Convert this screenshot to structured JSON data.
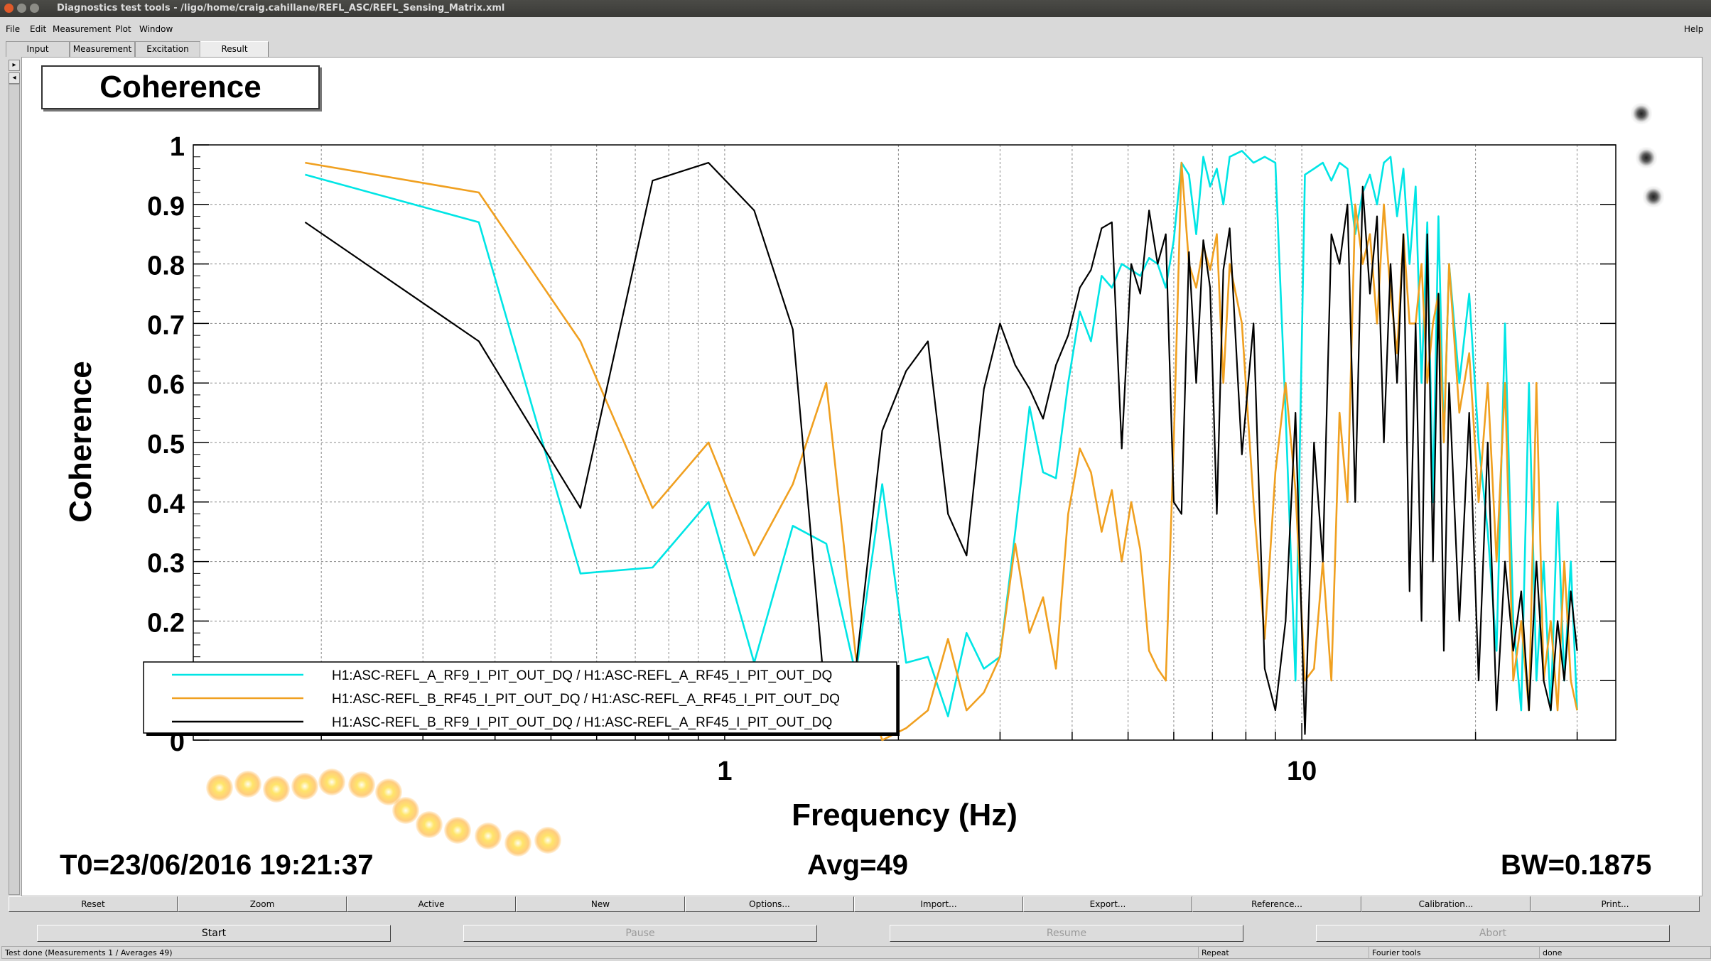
{
  "window": {
    "title": "Diagnostics test tools - /ligo/home/craig.cahillane/REFL_ASC/REFL_Sensing_Matrix.xml"
  },
  "menu": {
    "items": [
      "File",
      "Edit",
      "Measurement",
      "Plot",
      "Window"
    ],
    "help": "Help"
  },
  "tabs": [
    "Input",
    "Measurement",
    "Excitation",
    "Result"
  ],
  "active_tab": "Result",
  "plot_title": "Coherence",
  "status": {
    "t0": "T0=23/06/2016 19:21:37",
    "avg": "Avg=49",
    "bw": "BW=0.1875"
  },
  "buttons_row1": [
    "Reset",
    "Zoom",
    "Active",
    "New",
    "Options...",
    "Import...",
    "Export...",
    "Reference...",
    "Calibration...",
    "Print..."
  ],
  "buttons_row2": [
    "Start",
    "Pause",
    "Resume",
    "Abort"
  ],
  "statusbar": {
    "message": "Test done (Measurements 1 / Averages 49)",
    "repeat": "Repeat",
    "tools": "Fourier tools",
    "state": "done"
  },
  "colors": {
    "series_cyan": "#00e5e5",
    "series_orange": "#f0a020",
    "series_black": "#000000"
  },
  "chart_data": {
    "type": "line",
    "title": "",
    "xlabel": "Frequency (Hz)",
    "ylabel": "Coherence",
    "xscale": "log",
    "xlim": [
      0.12,
      35
    ],
    "ylim": [
      0,
      1
    ],
    "x_tick_labels": [
      "1",
      "10"
    ],
    "y_tick_labels": [
      "0",
      "0.1",
      "0.2",
      "0.3",
      "0.4",
      "0.5",
      "0.6",
      "0.7",
      "0.8",
      "0.9",
      "1"
    ],
    "grid": true,
    "legend_position": "bottom-left",
    "series": [
      {
        "name": "H1:ASC-REFL_A_RF9_I_PIT_OUT_DQ / H1:ASC-REFL_A_RF45_I_PIT_OUT_DQ",
        "color": "#00e5e5",
        "x": [
          0.1875,
          0.375,
          0.5625,
          0.75,
          0.9375,
          1.125,
          1.3125,
          1.5,
          1.6875,
          1.875,
          2.0625,
          2.25,
          2.4375,
          2.625,
          2.8125,
          3.0,
          3.1875,
          3.375,
          3.5625,
          3.75,
          3.9375,
          4.125,
          4.3125,
          4.5,
          4.6875,
          4.875,
          5.0625,
          5.25,
          5.4375,
          5.625,
          5.8125,
          6.0,
          6.1875,
          6.375,
          6.5625,
          6.75,
          6.9375,
          7.125,
          7.3125,
          7.5,
          7.875,
          8.25,
          8.625,
          9.0,
          9.375,
          9.75,
          10.125,
          10.5,
          10.875,
          11.25,
          11.625,
          12.0,
          12.375,
          12.75,
          13.125,
          13.5,
          13.875,
          14.25,
          14.625,
          15.0,
          15.375,
          15.75,
          16.125,
          16.5,
          16.875,
          17.25,
          17.625,
          18.0,
          18.75,
          19.5,
          20.25,
          21.0,
          21.75,
          22.5,
          23.25,
          24.0,
          24.75,
          25.5,
          26.25,
          27.0,
          27.75,
          28.5,
          29.25,
          30.0
        ],
        "y": [
          0.95,
          0.87,
          0.28,
          0.29,
          0.4,
          0.13,
          0.36,
          0.33,
          0.11,
          0.43,
          0.13,
          0.14,
          0.04,
          0.18,
          0.12,
          0.14,
          0.35,
          0.56,
          0.45,
          0.44,
          0.6,
          0.72,
          0.67,
          0.78,
          0.76,
          0.8,
          0.79,
          0.78,
          0.81,
          0.8,
          0.76,
          0.84,
          0.97,
          0.95,
          0.85,
          0.98,
          0.93,
          0.96,
          0.9,
          0.98,
          0.99,
          0.97,
          0.98,
          0.97,
          0.55,
          0.1,
          0.95,
          0.96,
          0.97,
          0.94,
          0.97,
          0.96,
          0.85,
          0.92,
          0.95,
          0.9,
          0.97,
          0.98,
          0.88,
          0.96,
          0.8,
          0.93,
          0.6,
          0.87,
          0.4,
          0.88,
          0.5,
          0.8,
          0.6,
          0.75,
          0.5,
          0.35,
          0.15,
          0.7,
          0.2,
          0.05,
          0.6,
          0.1,
          0.3,
          0.05,
          0.4,
          0.1,
          0.3,
          0.05
        ]
      },
      {
        "name": "H1:ASC-REFL_B_RF45_I_PIT_OUT_DQ / H1:ASC-REFL_A_RF45_I_PIT_OUT_DQ",
        "color": "#f0a020",
        "x": [
          0.1875,
          0.375,
          0.5625,
          0.75,
          0.9375,
          1.125,
          1.3125,
          1.5,
          1.6875,
          1.875,
          2.0625,
          2.25,
          2.4375,
          2.625,
          2.8125,
          3.0,
          3.1875,
          3.375,
          3.5625,
          3.75,
          3.9375,
          4.125,
          4.3125,
          4.5,
          4.6875,
          4.875,
          5.0625,
          5.25,
          5.4375,
          5.625,
          5.8125,
          6.0,
          6.1875,
          6.375,
          6.5625,
          6.75,
          6.9375,
          7.125,
          7.3125,
          7.5,
          7.875,
          8.25,
          8.625,
          9.0,
          9.375,
          9.75,
          10.125,
          10.5,
          10.875,
          11.25,
          11.625,
          12.0,
          12.375,
          12.75,
          13.125,
          13.5,
          13.875,
          14.25,
          14.625,
          15.0,
          15.375,
          15.75,
          16.125,
          16.5,
          16.875,
          17.25,
          17.625,
          18.0,
          18.75,
          19.5,
          20.25,
          21.0,
          21.75,
          22.5,
          23.25,
          24.0,
          24.75,
          25.5,
          26.25,
          27.0,
          27.75,
          28.5,
          29.25,
          30.0
        ],
        "y": [
          0.97,
          0.92,
          0.67,
          0.39,
          0.5,
          0.31,
          0.43,
          0.6,
          0.14,
          0.0,
          0.02,
          0.05,
          0.17,
          0.05,
          0.08,
          0.14,
          0.33,
          0.18,
          0.24,
          0.12,
          0.38,
          0.49,
          0.45,
          0.35,
          0.42,
          0.3,
          0.4,
          0.32,
          0.15,
          0.12,
          0.1,
          0.5,
          0.97,
          0.8,
          0.76,
          0.83,
          0.79,
          0.85,
          0.6,
          0.8,
          0.7,
          0.4,
          0.17,
          0.45,
          0.6,
          0.42,
          0.1,
          0.12,
          0.3,
          0.1,
          0.55,
          0.4,
          0.9,
          0.8,
          0.85,
          0.7,
          0.9,
          0.75,
          0.65,
          0.85,
          0.7,
          0.7,
          0.8,
          0.6,
          0.7,
          0.75,
          0.5,
          0.8,
          0.55,
          0.65,
          0.4,
          0.6,
          0.3,
          0.6,
          0.1,
          0.2,
          0.05,
          0.6,
          0.1,
          0.2,
          0.05,
          0.3,
          0.1,
          0.05
        ]
      },
      {
        "name": "H1:ASC-REFL_B_RF9_I_PIT_OUT_DQ / H1:ASC-REFL_A_RF45_I_PIT_OUT_DQ",
        "color": "#000000",
        "x": [
          0.1875,
          0.375,
          0.5625,
          0.75,
          0.9375,
          1.125,
          1.3125,
          1.5,
          1.6875,
          1.875,
          2.0625,
          2.25,
          2.4375,
          2.625,
          2.8125,
          3.0,
          3.1875,
          3.375,
          3.5625,
          3.75,
          3.9375,
          4.125,
          4.3125,
          4.5,
          4.6875,
          4.875,
          5.0625,
          5.25,
          5.4375,
          5.625,
          5.8125,
          6.0,
          6.1875,
          6.375,
          6.5625,
          6.75,
          6.9375,
          7.125,
          7.3125,
          7.5,
          7.875,
          8.25,
          8.625,
          9.0,
          9.375,
          9.75,
          10.125,
          10.5,
          10.875,
          11.25,
          11.625,
          12.0,
          12.375,
          12.75,
          13.125,
          13.5,
          13.875,
          14.25,
          14.625,
          15.0,
          15.375,
          15.75,
          16.125,
          16.5,
          16.875,
          17.25,
          17.625,
          18.0,
          18.75,
          19.5,
          20.25,
          21.0,
          21.75,
          22.5,
          23.25,
          24.0,
          24.75,
          25.5,
          26.25,
          27.0,
          27.75,
          28.5,
          29.25,
          30.0
        ],
        "y": [
          0.87,
          0.67,
          0.39,
          0.94,
          0.97,
          0.89,
          0.69,
          0.05,
          0.12,
          0.52,
          0.62,
          0.67,
          0.38,
          0.31,
          0.59,
          0.7,
          0.63,
          0.59,
          0.54,
          0.63,
          0.68,
          0.76,
          0.79,
          0.86,
          0.87,
          0.49,
          0.8,
          0.75,
          0.89,
          0.8,
          0.85,
          0.4,
          0.38,
          0.82,
          0.6,
          0.84,
          0.76,
          0.38,
          0.79,
          0.86,
          0.48,
          0.7,
          0.12,
          0.05,
          0.2,
          0.55,
          0.01,
          0.5,
          0.3,
          0.85,
          0.8,
          0.9,
          0.4,
          0.93,
          0.75,
          0.88,
          0.5,
          0.8,
          0.6,
          0.85,
          0.25,
          0.7,
          0.2,
          0.85,
          0.3,
          0.75,
          0.15,
          0.6,
          0.2,
          0.55,
          0.1,
          0.5,
          0.05,
          0.3,
          0.15,
          0.25,
          0.05,
          0.3,
          0.1,
          0.05,
          0.2,
          0.1,
          0.25,
          0.15
        ]
      }
    ]
  }
}
